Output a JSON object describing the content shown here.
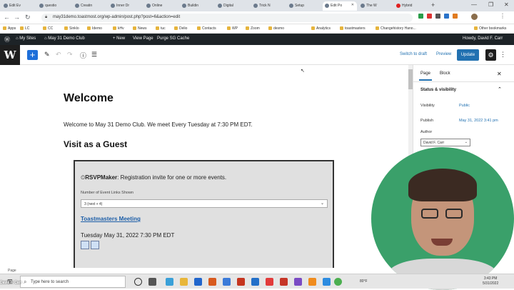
{
  "browser": {
    "tabs": [
      "Edit Ev",
      "questio",
      "Creatin",
      "Inner Dr",
      "Online",
      "Buildin",
      "Digital",
      "Trick N",
      "Setup",
      "Edit Po",
      "The W",
      "Hybrid"
    ],
    "active_tab_index": 9,
    "url": "may31demo.toastmost.org/wp-admin/post.php?post=6&action=edit",
    "bookmarks": [
      "Apps",
      "LC",
      "CC",
      "Sinklo",
      "Idemo",
      "kHv",
      "News",
      "tuc",
      "Delio",
      "Contacts",
      "WP",
      "Zoom",
      "desmo",
      "Analytics",
      "toastmasters",
      "Changehistory Hano...",
      "Other bookmarks"
    ]
  },
  "admin_bar": {
    "my_sites": "My Sites",
    "site_name": "May 31 Demo Club",
    "new": "New",
    "view_page": "View Page",
    "purge": "Purge SG Cache",
    "howdy": "Howdy, David F. Carr"
  },
  "editor": {
    "switch_draft": "Switch to draft",
    "preview": "Preview",
    "update": "Update"
  },
  "content": {
    "title": "Welcome",
    "paragraph": "Welcome to May 31 Demo Club. We meet Every Tuesday at 7:30 PM EDT.",
    "heading": "Visit as a Guest",
    "rsvp_brand": "RSVPMaker",
    "rsvp_desc": ": Registration invite for one or more events.",
    "events_label": "Number of Event Links Shown",
    "events_value": "3 (next + 4)",
    "event_link": "Toastmasters Meeting",
    "event_date": "Tuesday May 31, 2022 7:30 PM EDT"
  },
  "sidebar": {
    "tab_page": "Page",
    "tab_block": "Block",
    "section": "Status & visibility",
    "visibility_label": "Visibility",
    "visibility_value": "Public",
    "publish_label": "Publish",
    "publish_value": "May 31, 2022 3:41 pm",
    "author_label": "Author",
    "author_value": "David F. Carr"
  },
  "status_bar": "Page",
  "taskbar": {
    "search_placeholder": "Type here to search",
    "temp": "80°F",
    "time": "3:43 PM",
    "date": "5/31/2022"
  },
  "webcam_name": "David F. Carr",
  "colors": {
    "wp_blue": "#2271b1",
    "admin_bar": "#1d2327",
    "webcam_bg": "#3aa06a"
  }
}
